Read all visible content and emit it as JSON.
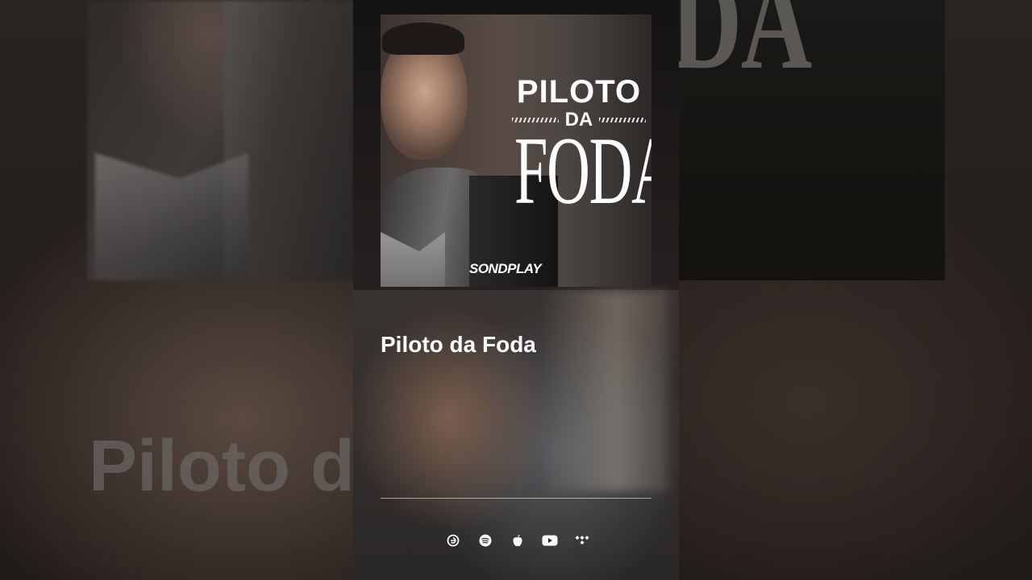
{
  "background": {
    "ghost_word": "DA",
    "ghost_title": "Piloto d"
  },
  "cover": {
    "line1": "PILOTO",
    "line2": "DA",
    "line3": "FODA",
    "brand": "SONDPLAY"
  },
  "track": {
    "title": "Piloto da Foda"
  },
  "platforms": [
    {
      "name": "custom-platform-icon"
    },
    {
      "name": "spotify-icon"
    },
    {
      "name": "apple-music-icon"
    },
    {
      "name": "youtube-icon"
    },
    {
      "name": "tidal-icon"
    }
  ],
  "colors": {
    "text": "#ffffff",
    "divider": "#d9d9d9",
    "background": "#1a1715"
  }
}
